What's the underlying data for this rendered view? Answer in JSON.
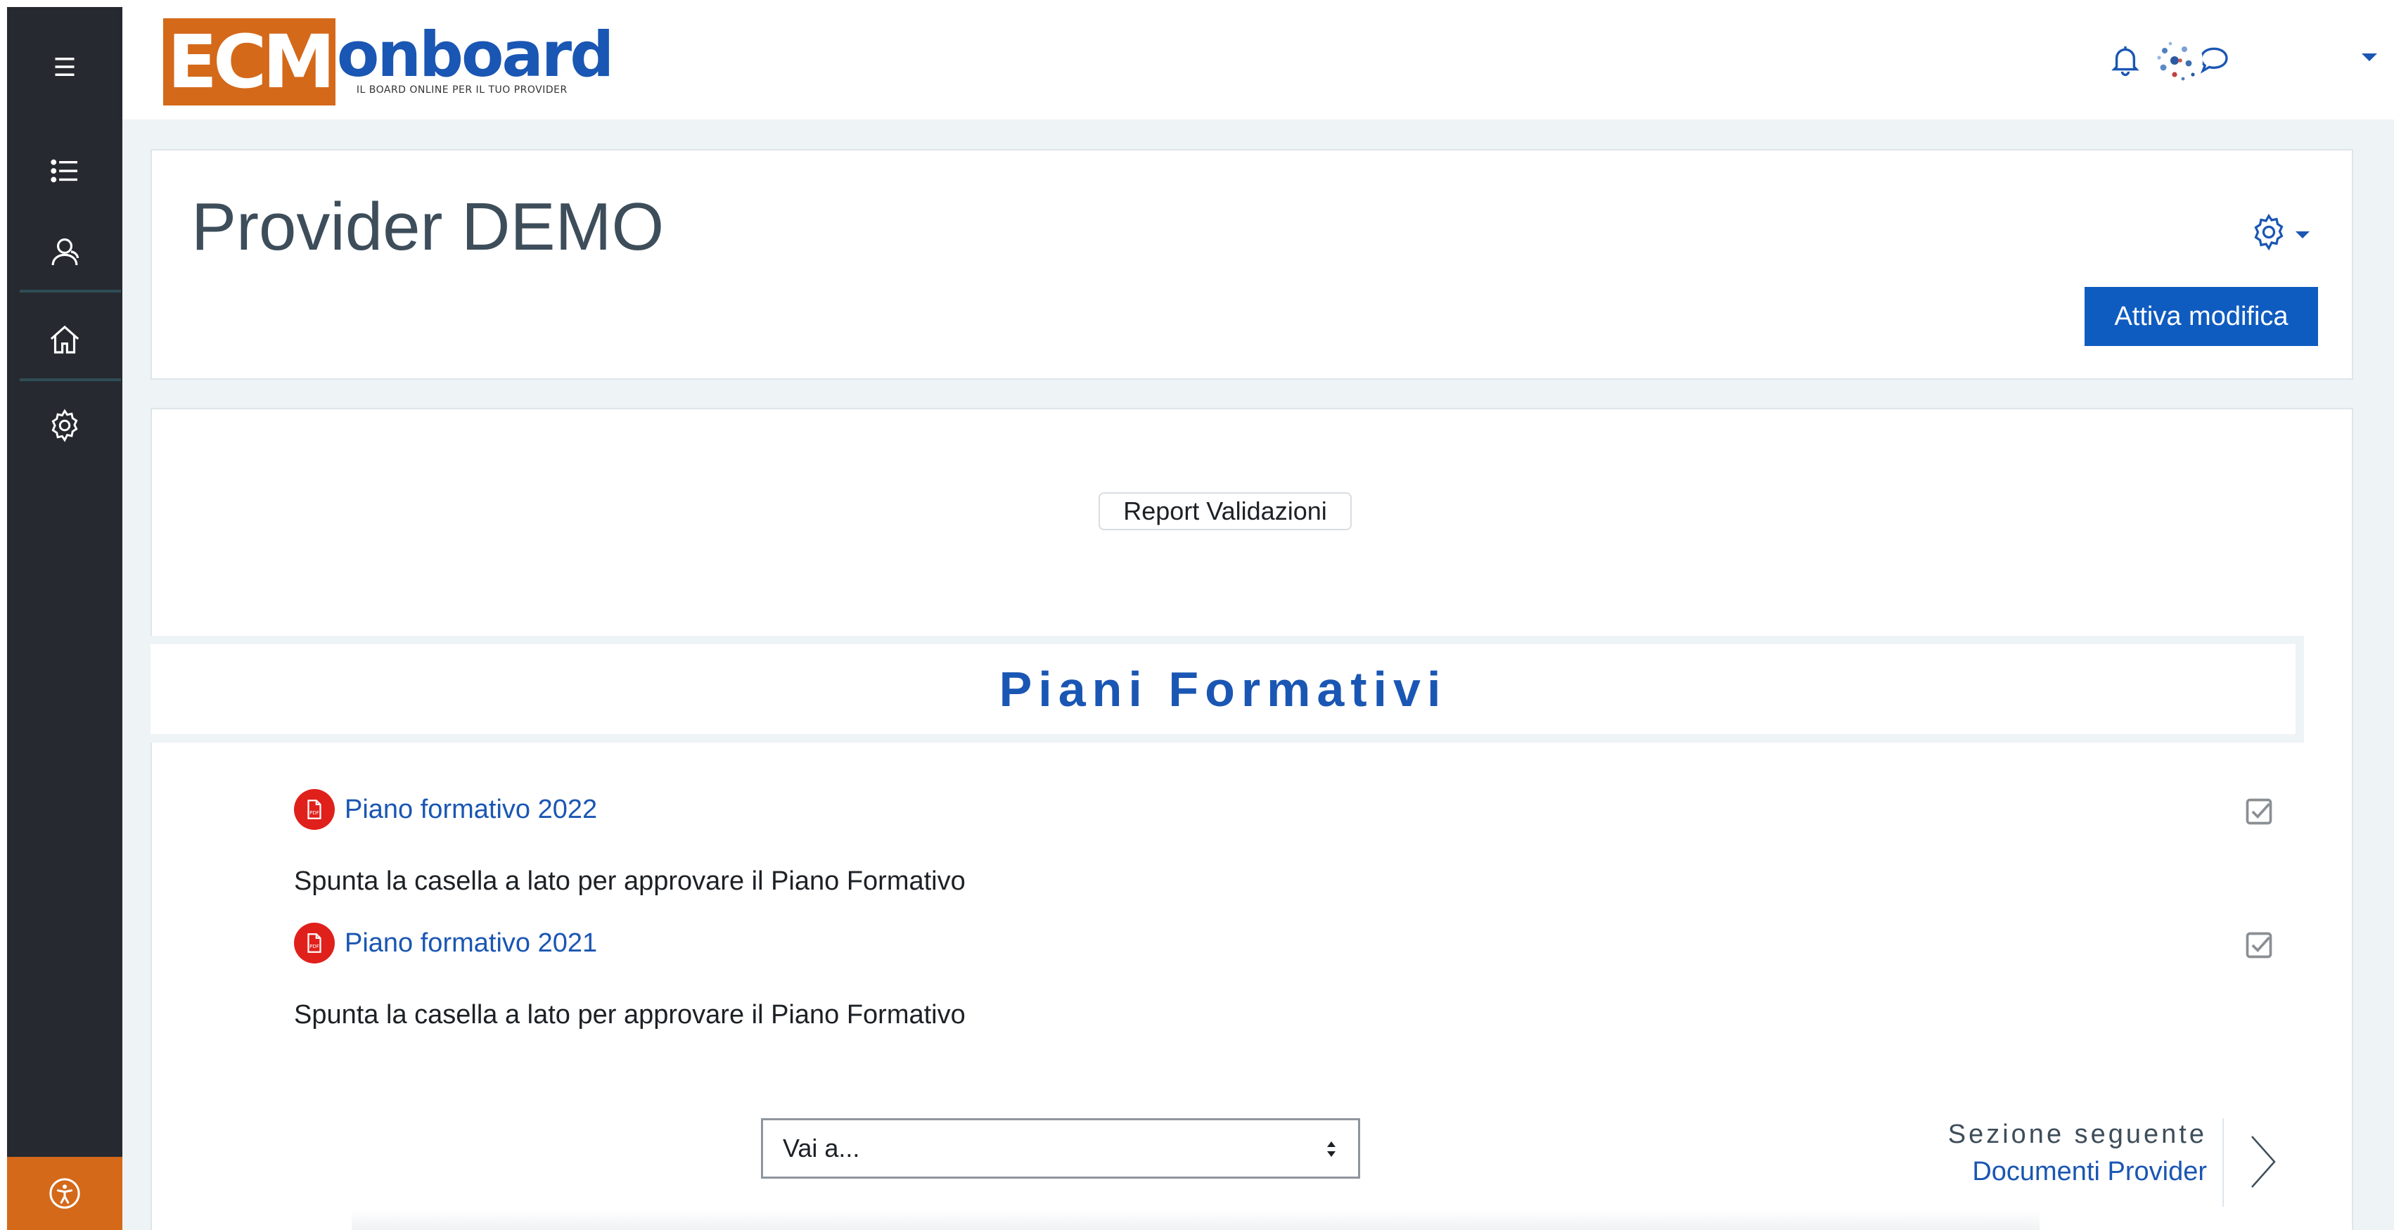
{
  "brand": {
    "logo_primary": "ECM",
    "logo_secondary": "onboard",
    "tagline": "IL BOARD ONLINE PER IL TUO PROVIDER",
    "accent_orange": "#d4691a",
    "accent_blue": "#1a56b3"
  },
  "sidebar": {
    "items": [
      {
        "icon": "hamburger-icon"
      },
      {
        "icon": "list-icon"
      },
      {
        "icon": "participants-icon"
      },
      {
        "icon": "home-icon"
      },
      {
        "icon": "gear-icon"
      }
    ],
    "accessibility_icon": "accessibility-icon"
  },
  "navbar": {
    "icons": [
      "bell-icon",
      "chat-icon",
      "avatar",
      "chevron-down-icon"
    ]
  },
  "header": {
    "title": "Provider DEMO",
    "edit_button": "Attiva modifica"
  },
  "content": {
    "report_button": "Report Validazioni",
    "section_title": "Piani Formativi",
    "activities": [
      {
        "title": "Piano formativo 2022",
        "description": "Spunta la casella a lato per approvare il Piano Formativo",
        "icon": "pdf-icon",
        "completed": true
      },
      {
        "title": "Piano formativo 2021",
        "description": "Spunta la casella a lato per approvare il Piano Formativo",
        "icon": "pdf-icon",
        "completed": true
      }
    ],
    "jump_select": {
      "selected": "Vai a..."
    },
    "next_section": {
      "label": "Sezione seguente",
      "link": "Documenti Provider"
    }
  }
}
